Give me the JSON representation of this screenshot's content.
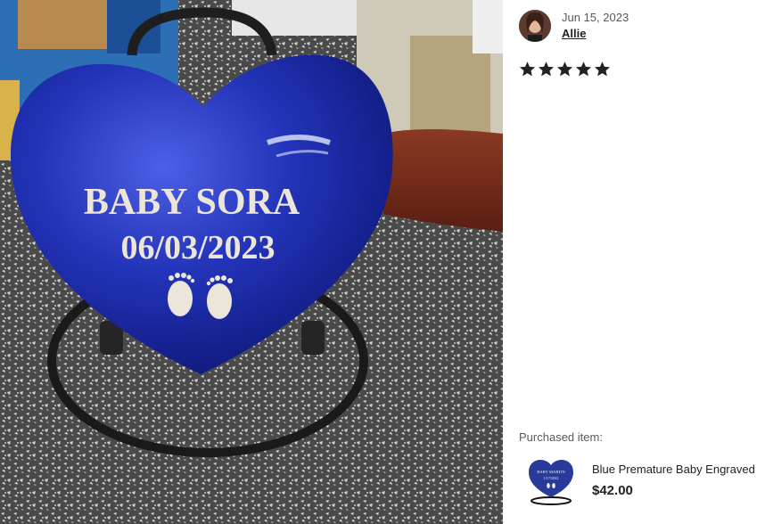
{
  "photo": {
    "alt_subject": "heart-urn-photo",
    "engraving": {
      "name": "BABY SORA",
      "date": "06/03/2023"
    }
  },
  "review": {
    "date": "Jun 15, 2023",
    "reviewer": "Allie",
    "rating": 5,
    "max_rating": 5
  },
  "purchased": {
    "label": "Purchased item:",
    "title": "Blue Premature Baby Engraved",
    "price": "$42.00",
    "thumb_engraving": {
      "name": "BABY MARTIN",
      "date": "1/17/2022"
    }
  },
  "colors": {
    "star": "#222222",
    "urn_blue": "#1f2fa8",
    "text_muted": "#595959"
  }
}
